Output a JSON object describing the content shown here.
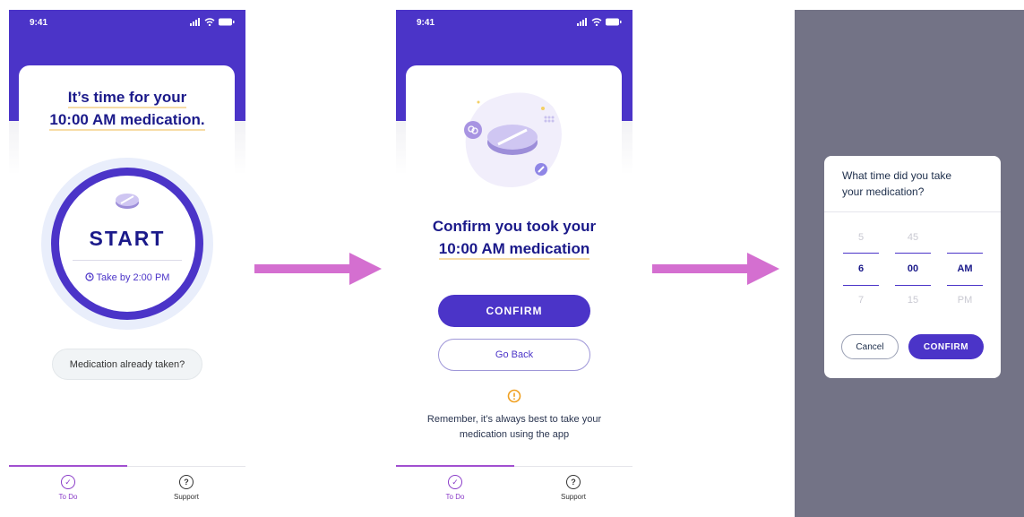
{
  "screen1": {
    "status_time": "9:41",
    "headline_line1": "It’s time for your",
    "headline_line2": "10:00 AM medication.",
    "start_label": "START",
    "take_by": "Take by 2:00 PM",
    "already_taken_label": "Medication already taken?",
    "tabs": [
      {
        "label": "To Do",
        "icon": "check-circle-icon"
      },
      {
        "label": "Support",
        "icon": "question-circle-icon"
      }
    ]
  },
  "screen2": {
    "status_time": "9:41",
    "headline_line1": "Confirm you took your",
    "headline_line2": "10:00 AM medication",
    "confirm_label": "CONFIRM",
    "go_back_label": "Go Back",
    "reminder_line1": "Remember, it’s always best to take your",
    "reminder_line2": "medication using the app",
    "tabs": [
      {
        "label": "To Do",
        "icon": "check-circle-icon"
      },
      {
        "label": "Support",
        "icon": "question-circle-icon"
      }
    ]
  },
  "dialog": {
    "question_line1": "What time did you take",
    "question_line2": "your medication?",
    "hours": [
      "5",
      "6",
      "7"
    ],
    "minutes": [
      "45",
      "00",
      "15"
    ],
    "meridiem": [
      "",
      "AM",
      "PM"
    ],
    "cancel_label": "Cancel",
    "confirm_label": "CONFIRM"
  },
  "colors": {
    "brand": "#4b34c8",
    "navy": "#1b1a8a",
    "arrow": "#d46fd0",
    "warning": "#f0a020",
    "tab_active": "#8a3cc8"
  }
}
